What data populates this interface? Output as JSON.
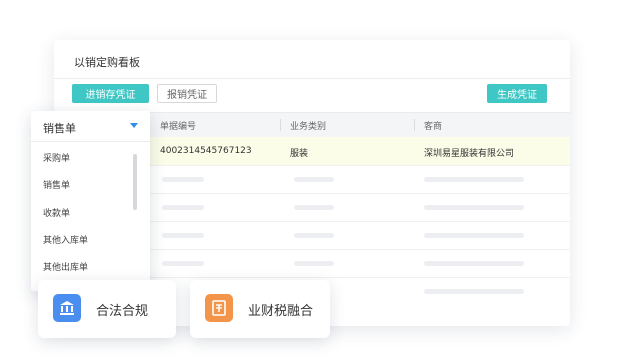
{
  "panel": {
    "title": "以销定购看板",
    "btn_generate_stock": "进销存凭证",
    "btn_expense": "报销凭证",
    "btn_create": "生成凭证"
  },
  "table": {
    "headers": [
      "单据编号",
      "业务类别",
      "客商"
    ],
    "rows": [
      {
        "doc_no": "4002314545767123",
        "category": "服装",
        "partner": "深圳易星服装有限公司"
      }
    ]
  },
  "dropdown": {
    "selected": "销售单",
    "options": [
      "采购单",
      "销售单",
      "收款单",
      "其他入库单",
      "其他出库单"
    ]
  },
  "cards": [
    {
      "label": "合法合规",
      "icon": "bank-icon"
    },
    {
      "label": "业财税融合",
      "icon": "ledger-icon"
    }
  ],
  "colors": {
    "accent": "#3ec7c4",
    "caret": "#2f8fe8",
    "highlight_row": "#fbfde8"
  }
}
